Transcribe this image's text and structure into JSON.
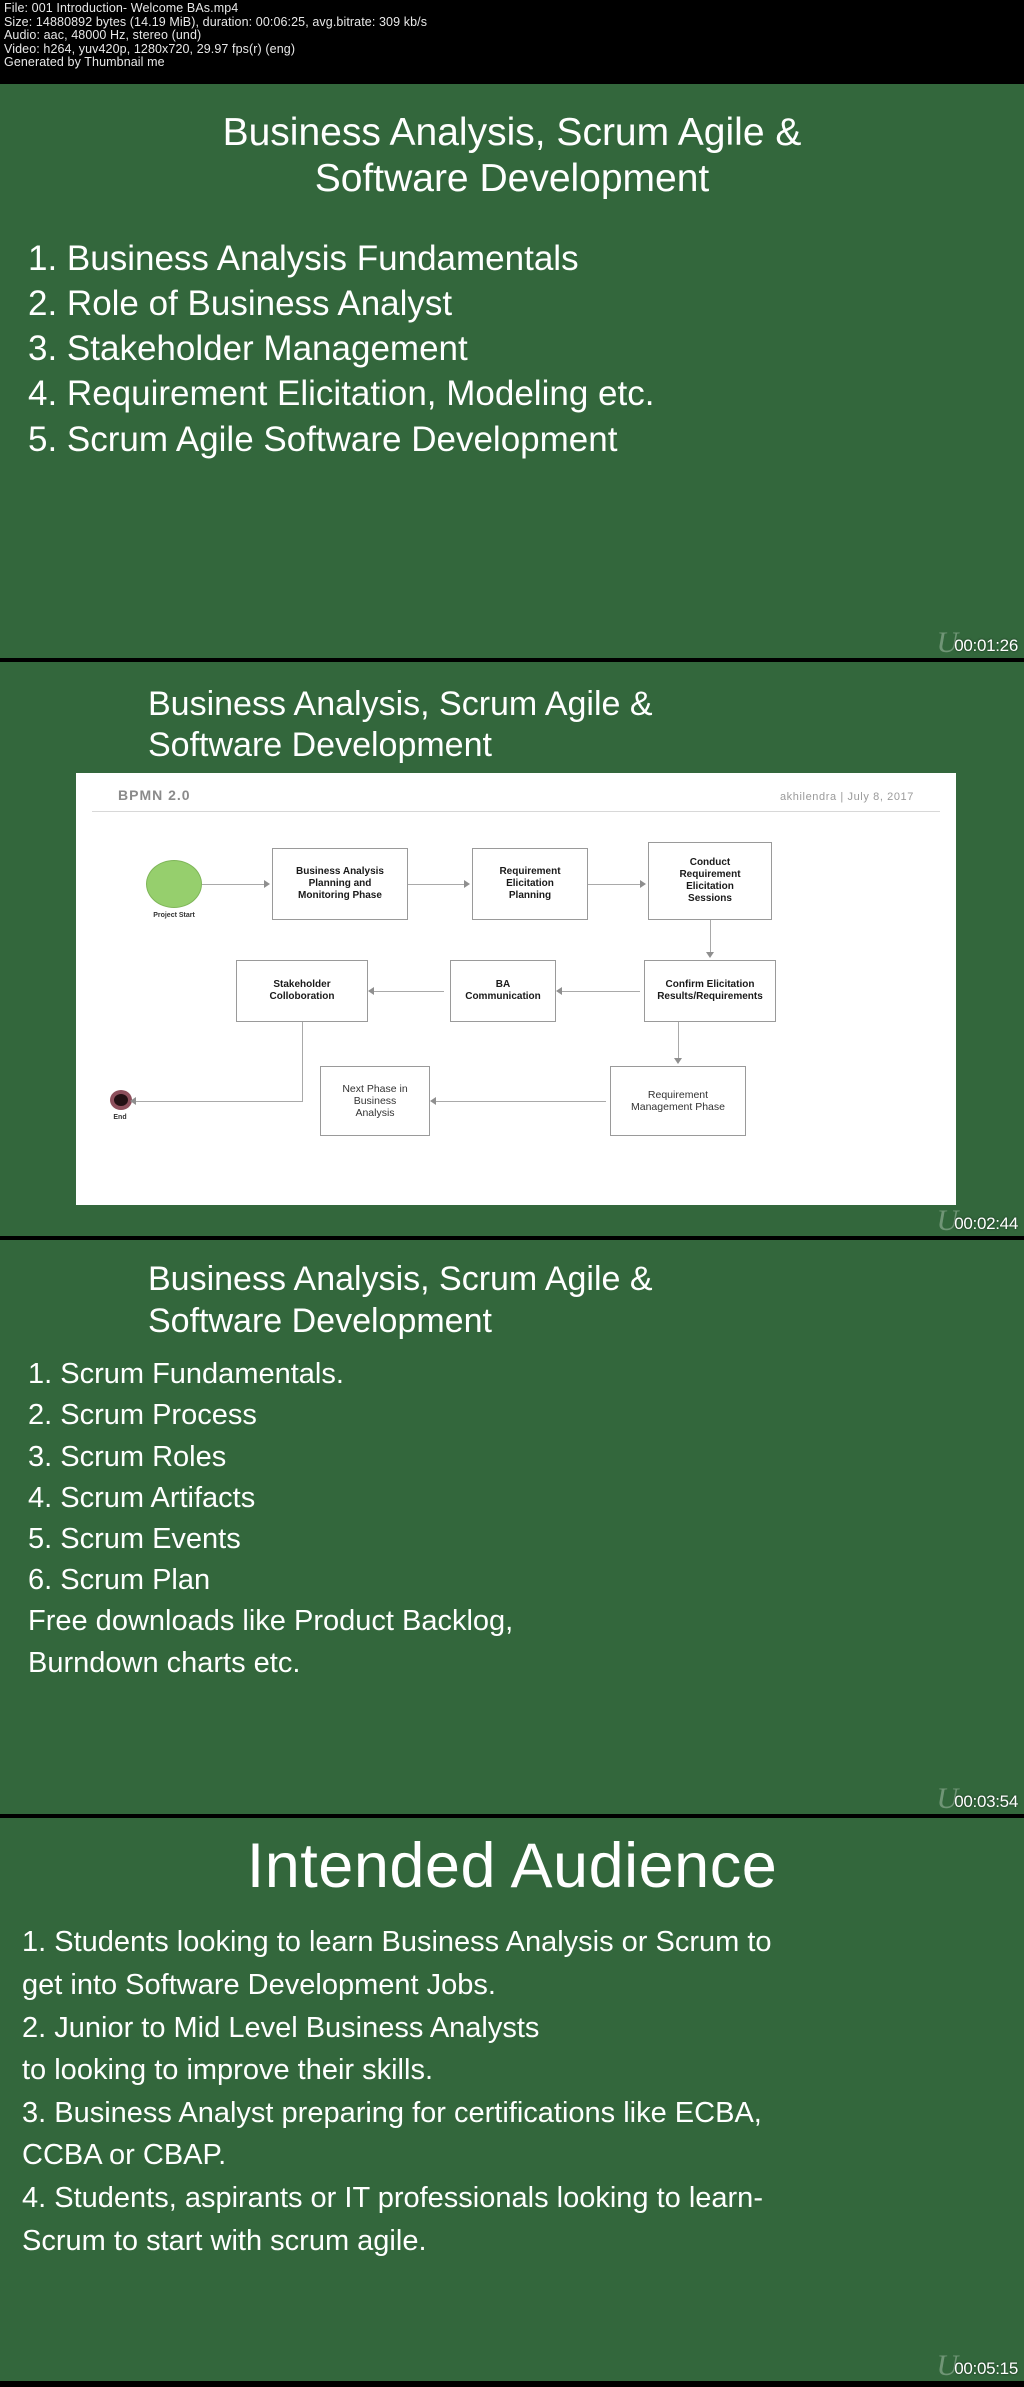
{
  "header": {
    "lines": [
      "File: 001 Introduction- Welcome BAs.mp4",
      "Size: 14880892 bytes (14.19 MiB), duration: 00:06:25, avg.bitrate: 309 kb/s",
      "Audio: aac, 48000 Hz, stereo (und)",
      "Video: h264, yuv420p, 1280x720, 29.97 fps(r) (eng)",
      "Generated by Thumbnail me"
    ]
  },
  "theme": {
    "background": "#33673c",
    "text": "#ffffff",
    "header_background": "#000000",
    "card_background": "#ffffff",
    "start_event_fill": "#96cf6d",
    "end_event_fill": "#231014"
  },
  "slides": [
    {
      "timestamp": "00:01:26",
      "watermark": "Udemy",
      "title_lines": [
        "Business Analysis, Scrum Agile &",
        "Software Development"
      ],
      "bullets": [
        "1. Business Analysis Fundamentals",
        "2. Role of Business Analyst",
        "3. Stakeholder Management",
        "4. Requirement Elicitation, Modeling etc.",
        "5. Scrum Agile Software Development"
      ]
    },
    {
      "timestamp": "00:02:44",
      "watermark": "Udemy",
      "title_lines": [
        "Business Analysis, Scrum Agile &",
        "Software Development"
      ],
      "diagram": {
        "logo": "BPMN 2.0",
        "byline": "akhilendra   |   July 8, 2017",
        "start_label": "Project Start",
        "end_label": "End",
        "nodes": [
          "Business Analysis Planning and Monitoring Phase",
          "Requirement Elicitation Planning",
          "Conduct Requirement Elicitation Sessions",
          "Confirm Elicitation Results/Requirements",
          "BA Communication",
          "Stakeholder Colloboration",
          "Requirement Management Phase",
          "Next Phase in Business Analysis"
        ],
        "node_lines": {
          "n1": [
            "Business Analysis",
            "Planning and",
            "Monitoring Phase"
          ],
          "n2": [
            "Requirement",
            "Elicitation",
            "Planning"
          ],
          "n3": [
            "Conduct",
            "Requirement",
            "Elicitation",
            "Sessions"
          ],
          "n4": [
            "Confirm Elicitation",
            "Results/Requirements"
          ],
          "n5": [
            "BA",
            "Communication"
          ],
          "n6": [
            "Stakeholder",
            "Colloboration"
          ],
          "n7": [
            "Requirement",
            "Management Phase"
          ],
          "n8": [
            "Next Phase in",
            "Business",
            "Analysis"
          ]
        }
      }
    },
    {
      "timestamp": "00:03:54",
      "watermark": "Udemy",
      "title_lines": [
        "Business Analysis, Scrum Agile &",
        "Software Development"
      ],
      "bullets": [
        "1. Scrum Fundamentals.",
        "2. Scrum Process",
        "3. Scrum Roles",
        "4. Scrum Artifacts",
        "5. Scrum Events",
        "6. Scrum Plan",
        "Free downloads like Product Backlog,",
        "Burndown charts etc."
      ]
    },
    {
      "timestamp": "00:05:15",
      "watermark": "Udemy",
      "title": "Intended Audience",
      "bullets": [
        "1. Students looking to learn Business Analysis or Scrum to",
        "get into Software Development Jobs.",
        "2. Junior to Mid Level Business Analysts",
        "to looking to improve their skills.",
        "3. Business Analyst preparing for certifications like ECBA,",
        "CCBA or CBAP.",
        "4. Students, aspirants or IT professionals looking to learn-",
        "Scrum to start with scrum agile."
      ]
    }
  ]
}
